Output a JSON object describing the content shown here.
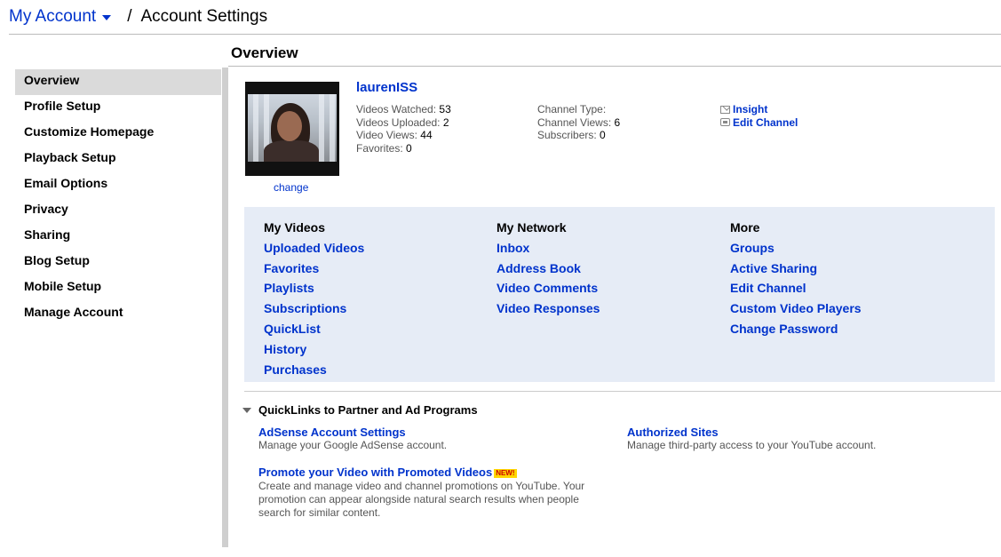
{
  "header": {
    "account": "My Account",
    "separator": "/",
    "title": "Account Settings"
  },
  "content": {
    "title": "Overview"
  },
  "sidebar": {
    "items": [
      {
        "label": "Overview",
        "active": true
      },
      {
        "label": "Profile Setup"
      },
      {
        "label": "Customize Homepage"
      },
      {
        "label": "Playback Setup"
      },
      {
        "label": "Email Options"
      },
      {
        "label": "Privacy"
      },
      {
        "label": "Sharing"
      },
      {
        "label": "Blog Setup"
      },
      {
        "label": "Mobile Setup"
      },
      {
        "label": "Manage Account"
      }
    ]
  },
  "profile": {
    "username": "laurenISS",
    "change": "change",
    "stats_left": [
      {
        "label": "Videos Watched:",
        "value": "53"
      },
      {
        "label": "Videos Uploaded:",
        "value": "2"
      },
      {
        "label": "Video Views:",
        "value": "44"
      },
      {
        "label": "Favorites:",
        "value": "0"
      }
    ],
    "stats_mid": [
      {
        "label": "Channel Type:",
        "value": ""
      },
      {
        "label": "Channel Views:",
        "value": "6"
      },
      {
        "label": "Subscribers:",
        "value": "0"
      }
    ],
    "links": [
      {
        "label": "Insight",
        "icon": "envelope-icon"
      },
      {
        "label": "Edit Channel",
        "icon": "tv-icon"
      }
    ]
  },
  "panel": {
    "columns": [
      {
        "header": "My Videos",
        "links": [
          "Uploaded Videos",
          "Favorites",
          "Playlists",
          "Subscriptions",
          "QuickList",
          "History",
          "Purchases"
        ]
      },
      {
        "header": "My Network",
        "links": [
          "Inbox",
          "Address Book",
          "Video Comments",
          "Video Responses"
        ]
      },
      {
        "header": "More",
        "links": [
          "Groups",
          "Active Sharing",
          "Edit Channel",
          "Custom Video Players",
          "Change Password"
        ]
      }
    ]
  },
  "quicklinks": {
    "header": "QuickLinks to Partner and Ad Programs",
    "adsense": {
      "title": "AdSense Account Settings",
      "desc": "Manage your Google AdSense account."
    },
    "authorized": {
      "title": "Authorized Sites",
      "desc": "Manage third-party access to your YouTube account."
    },
    "promote": {
      "title": "Promote your Video with Promoted Videos",
      "badge": "NEW!",
      "desc": "Create and manage video and channel promotions on YouTube. Your promotion can appear alongside natural search results when people search for similar content."
    }
  }
}
